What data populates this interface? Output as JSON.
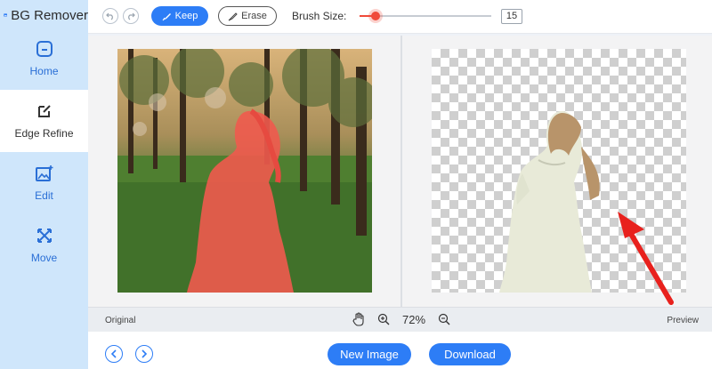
{
  "app": {
    "title": "BG Remover"
  },
  "sidebar": {
    "items": [
      {
        "label": "Home",
        "icon": "home-icon",
        "active": false
      },
      {
        "label": "Edge Refine",
        "icon": "edge-refine-icon",
        "active": true
      },
      {
        "label": "Edit",
        "icon": "edit-icon",
        "active": false
      },
      {
        "label": "Move",
        "icon": "move-icon",
        "active": false
      }
    ]
  },
  "toolbar": {
    "keep_label": "Keep",
    "erase_label": "Erase",
    "brush_size_label": "Brush Size:",
    "brush_size_value": "15",
    "brush_slider_fraction": 0.12
  },
  "info_bar": {
    "original_label": "Original",
    "preview_label": "Preview",
    "zoom_percent": "72%"
  },
  "footer": {
    "new_image_label": "New Image",
    "download_label": "Download"
  },
  "colors": {
    "accent": "#2d7df6",
    "keep_overlay": "#f05a4e",
    "sidebar_bg": "#cfe6fb",
    "annotation_arrow": "#e8211d"
  }
}
